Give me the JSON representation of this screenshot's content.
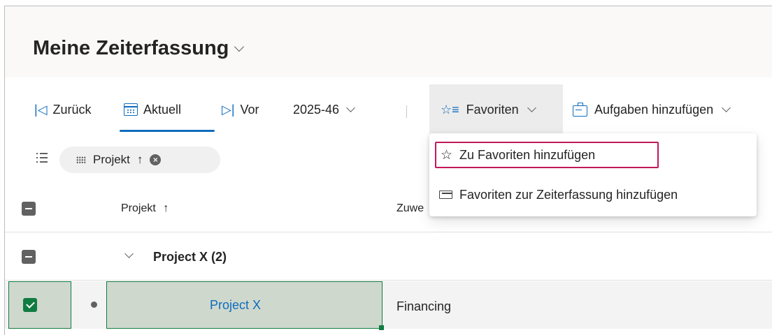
{
  "header": {
    "title": "Meine Zeiterfassung"
  },
  "toolbar": {
    "back_label": "Zurück",
    "current_label": "Aktuell",
    "next_label": "Vor",
    "week_value": "2025-46",
    "favorites_label": "Favoriten",
    "add_tasks_label": "Aufgaben hinzufügen"
  },
  "filter": {
    "pill_label": "Projekt",
    "sort_arrow": "↑",
    "clear_glyph": "×"
  },
  "grid": {
    "columns": [
      {
        "label": "Projekt",
        "sort_arrow": "↑"
      },
      {
        "label": "Zuwe"
      }
    ],
    "groups": [
      {
        "label": "Project X (2)",
        "rows": [
          {
            "project": "Project X",
            "assignment": "Financing",
            "selected": true
          }
        ]
      }
    ]
  },
  "favorites_menu": {
    "items": [
      {
        "label": "Zu Favoriten hinzufügen",
        "icon": "star-plus-icon",
        "highlighted": true
      },
      {
        "label": "Favoriten zur Zeiterfassung hinzufügen",
        "icon": "stack-icon"
      }
    ]
  },
  "colors": {
    "accent": "#0f6cbd",
    "selection_green": "#107c41",
    "selection_fill": "#cfd8cd",
    "highlight_border": "#c2185b",
    "favorites_bg": "#ececec"
  }
}
